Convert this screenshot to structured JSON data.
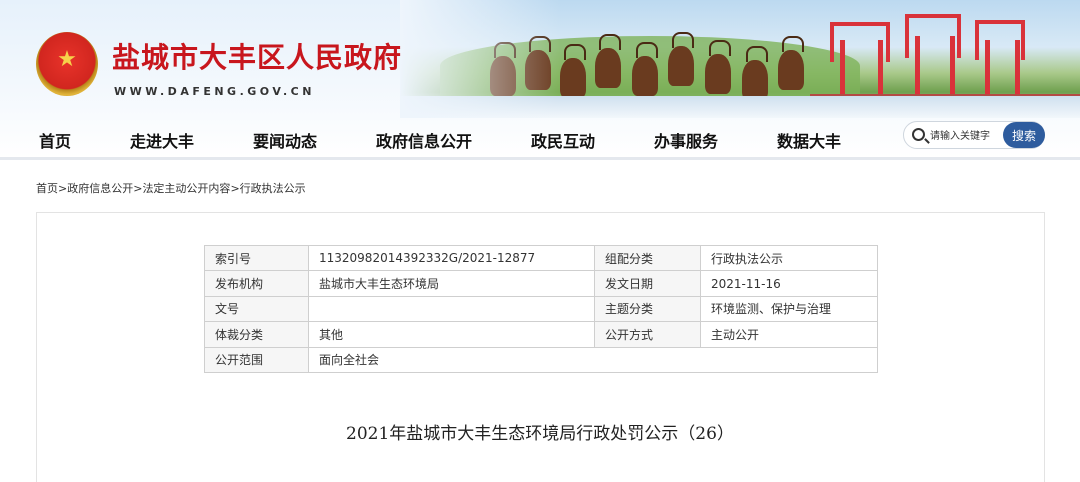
{
  "site": {
    "title": "盐城市大丰区人民政府",
    "url": "WWW.DAFENG.GOV.CN"
  },
  "nav": {
    "items": [
      "首页",
      "走进大丰",
      "要闻动态",
      "政府信息公开",
      "政民互动",
      "办事服务",
      "数据大丰"
    ]
  },
  "search": {
    "placeholder": "请输入关键字",
    "button_label": "搜索"
  },
  "breadcrumb": [
    "首页",
    "政府信息公开",
    "法定主动公开内容",
    "行政执法公示"
  ],
  "breadcrumb_sep": ">",
  "meta": {
    "rows": [
      {
        "label1": "索引号",
        "value1": "11320982014392332G/2021-12877",
        "label2": "组配分类",
        "value2": "行政执法公示"
      },
      {
        "label1": "发布机构",
        "value1": "盐城市大丰生态环境局",
        "label2": "发文日期",
        "value2": "2021-11-16"
      },
      {
        "label1": "文号",
        "value1": "",
        "label2": "主题分类",
        "value2": "环境监测、保护与治理"
      },
      {
        "label1": "体裁分类",
        "value1": "其他",
        "label2": "公开方式",
        "value2": "主动公开"
      },
      {
        "label1": "公开范围",
        "value1": "面向全社会"
      }
    ]
  },
  "article": {
    "title": "2021年盐城市大丰生态环境局行政处罚公示（26）"
  },
  "colors": {
    "title_red": "#c8161d",
    "search_button": "#2e5c9e"
  },
  "icons": {
    "emblem": "national-emblem",
    "search": "search-icon"
  }
}
